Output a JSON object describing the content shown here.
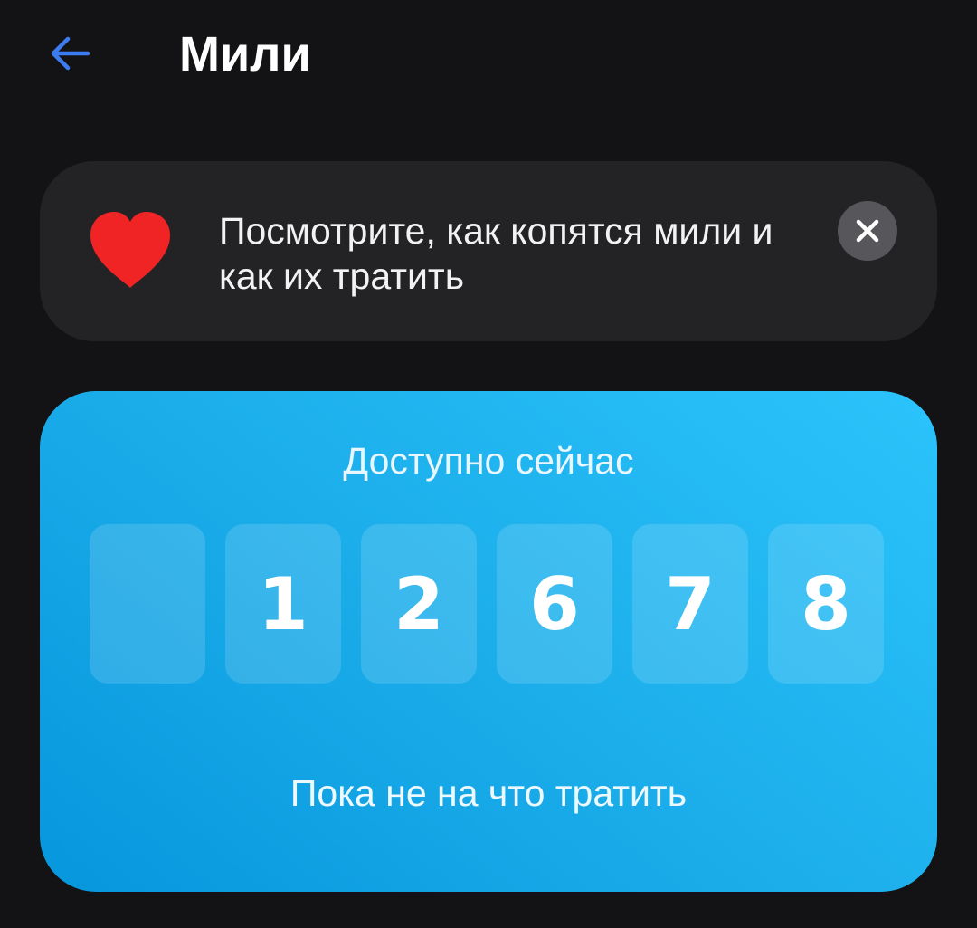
{
  "header": {
    "title": "Мили",
    "back_icon": "arrow-left-icon",
    "accent_color": "#3d7bf1"
  },
  "banner": {
    "icon": "heart-icon",
    "text": "Посмотрите, как копятся мили и как их тратить",
    "close_icon": "close-icon",
    "heart_color": "#f02424"
  },
  "miles_card": {
    "label": "Доступно сейчас",
    "balance": 12678,
    "digits": [
      "",
      "1",
      "2",
      "6",
      "7",
      "8"
    ],
    "footer": "Пока не на что тратить"
  }
}
